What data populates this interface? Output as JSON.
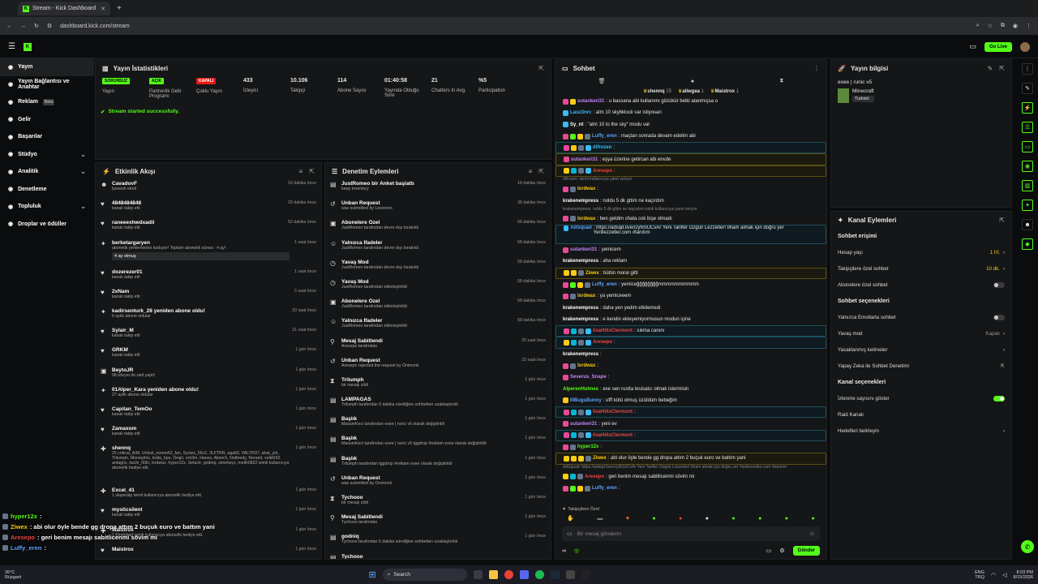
{
  "browser": {
    "tab_title": "Stream - Kick Dashboard",
    "url": "dashboard.kick.com/stream"
  },
  "topnav": {
    "go_live": "Go Live"
  },
  "sidebar": [
    {
      "label": "Yayın",
      "icon": "broadcast-icon",
      "active": true
    },
    {
      "label": "Yayın Bağlantısı ve Anahtar",
      "icon": "link-icon"
    },
    {
      "label": "Reklam",
      "icon": "ad-icon",
      "badge": "Beta"
    },
    {
      "label": "Gelir",
      "icon": "dollar-icon"
    },
    {
      "label": "Başarılar",
      "icon": "trophy-icon"
    },
    {
      "label": "Stüdyo",
      "icon": "studio-icon",
      "chev": "⌄"
    },
    {
      "label": "Analitik",
      "icon": "chart-icon",
      "chev": "⌄"
    },
    {
      "label": "Denetleme",
      "icon": "gavel-icon"
    },
    {
      "label": "Topluluk",
      "icon": "people-icon",
      "chev": "⌄"
    },
    {
      "label": "Droplar ve ödüller",
      "icon": "gift-icon"
    }
  ],
  "stats": {
    "title": "Yayın İstatistikleri",
    "items": [
      {
        "badge": "SORUNSUZ",
        "badge_color": "#53fc18",
        "label": "Yayın"
      },
      {
        "badge": "AÇIK",
        "badge_color": "#53fc18",
        "label": "Partnerlik Gelir Programı"
      },
      {
        "badge": "KAPALI",
        "badge_color": "#e91916",
        "label": "Çoklu Yayın"
      },
      {
        "value": "433",
        "label": "İzleyici"
      },
      {
        "value": "10.106",
        "label": "Takipçi"
      },
      {
        "value": "114",
        "label": "Abone Sayısı"
      },
      {
        "value": "01:40:58",
        "label": "Yayında Olduğu Süre"
      },
      {
        "value": "21",
        "label": "Chatters In Avg."
      },
      {
        "value": "%5",
        "label": "Participation"
      }
    ],
    "toast": "Stream started successfully."
  },
  "activity": {
    "title": "Etkinlik Akışı",
    "rows": [
      {
        "i": "☻",
        "n": "CavadovF",
        "s": "lyesesh ekrdı",
        "t": "16 dakika önce"
      },
      {
        "i": "♥",
        "n": "4848484848",
        "s": "kanalı takip etti",
        "t": "20 dakika önce"
      },
      {
        "i": "♥",
        "n": "raneeexhwdxadil",
        "s": "kanalı takip etti",
        "t": "52 dakika önce"
      },
      {
        "i": "✦",
        "n": "berketargaryen",
        "s": "abonelik yenilemesini kutluyor! Toplam abonelik süresi - 4 ay!",
        "t": "1 saat önce",
        "x": "4 ay olmuş"
      },
      {
        "i": "♥",
        "n": "dozerezer01",
        "s": "kanalı takip etti",
        "t": "1 saat önce"
      },
      {
        "i": "♥",
        "n": "2xNam",
        "s": "kanalı takip etti",
        "t": "5 saat önce"
      },
      {
        "i": "✦",
        "n": "kadirsenturk_28 yeniden abone oldu!",
        "s": "6 aylık abone oldular",
        "t": "20 saat önce"
      },
      {
        "i": "♥",
        "n": "Sylair_M",
        "s": "kanalı takip etti",
        "t": "21 saat önce"
      },
      {
        "i": "♥",
        "n": "GRKM",
        "s": "kanalı takip etti",
        "t": "1 gün önce"
      },
      {
        "i": "▣",
        "n": "BeytoJR",
        "s": "98 izleyici ile raid yaptı!",
        "t": "1 gün önce"
      },
      {
        "i": "✦",
        "n": "01Alper_Kara yeniden abone oldu!",
        "s": "27 aylık abone oldular",
        "t": "1 gün önce"
      },
      {
        "i": "♥",
        "n": "Capitan_TemOo",
        "s": "kanalı takip etti",
        "t": "1 gün önce"
      },
      {
        "i": "♥",
        "n": "Zamaxom",
        "s": "kanalı takip etti",
        "t": "1 gün önce"
      },
      {
        "i": "✚",
        "n": "shennq",
        "s": "25 critical_AIM, Unlost_memo62_fan, Synizx_56v2, 3LFTRN, aga60, VALYR37, ahat_yrk, Trilumph, Morsephix, bolta_hpo, Orajri, erk3m, Hanex, AlizerX, Notfeedy, Noraml, volkl043, antagnz, itachi_00ln, lxrdwax, hyper12x, Sefactr, godniq, simetwyz, melih0822 isimli kullanıcıya abonelik hediye etti.",
        "t": "1 gün önce",
        "tall": true
      },
      {
        "i": "✚",
        "n": "Excel_41",
        "s": "1 slayeralp isimli kullanıcıya abonelik hediye etti.",
        "t": "1 gün önce"
      },
      {
        "i": "♥",
        "n": "mysticsilent",
        "s": "kanalı takip etti",
        "t": "1 gün önce"
      },
      {
        "i": "✚",
        "n": "Maistrox",
        "s": "1 Kirplebad isimli kullanıcıya abonelik hediye etti.",
        "t": "1 gün önce"
      },
      {
        "i": "♥",
        "n": "Maistrox",
        "s": "",
        "t": "1 gün önce"
      }
    ]
  },
  "moderation": {
    "title": "Denetim Eylemleri",
    "rows": [
      {
        "i": "▤",
        "n": "JustRomeo bir Anket başlattı",
        "s": "keep inventory",
        "t": "18 dakika önce"
      },
      {
        "i": "↺",
        "n": "Unban Request",
        "s": "was submitted by Lexionnn",
        "t": "38 dakika önce"
      },
      {
        "i": "▣",
        "n": "Abonelere Özel",
        "s": "JustRomeo tarafından devre dışı bırakıldı",
        "t": "58 dakika önce"
      },
      {
        "i": "☺",
        "n": "Yalnızca İfadeler",
        "s": "JustRomeo tarafından devre dışı bırakıldı",
        "t": "58 dakika önce"
      },
      {
        "i": "◷",
        "n": "Yavaş Mod",
        "s": "JustRomeo tarafından devre dışı bırakıldı",
        "t": "58 dakika önce"
      },
      {
        "i": "◷",
        "n": "Yavaş Mod",
        "s": "JustRomeo tarafından etkinleştirildi",
        "t": "58 dakika önce"
      },
      {
        "i": "▣",
        "n": "Abonelere Özel",
        "s": "JustRomeo tarafından etkinleştirildi",
        "t": "58 dakika önce"
      },
      {
        "i": "☺",
        "n": "Yalnızca İfadeler",
        "s": "JustRomeo tarafından etkinleştirildi",
        "t": "58 dakika önce"
      },
      {
        "i": "⚲",
        "n": "Mesaj Sabitlendi",
        "s": "Aresepo tarafından",
        "t": "20 saat önce"
      },
      {
        "i": "↺",
        "n": "Unban Request",
        "s": "Aresepo rejected the request by Onimonii",
        "t": "22 saat önce"
      },
      {
        "i": "⧗",
        "n": "Trilumph",
        "s": "bir mesajı sildi",
        "t": "1 gün önce"
      },
      {
        "i": "▤",
        "n": "LAMPAGAS",
        "s": "Trilumph tarafından 5 dakika süreliğine sohbetten uzaklaştırıldı",
        "t": "1 gün önce"
      },
      {
        "i": "▤",
        "n": "Başlık",
        "s": "MasumKeci tarafından exee | runic v5 olarak değiştirildi",
        "t": "1 gün önce"
      },
      {
        "i": "▤",
        "n": "Başlık",
        "s": "MasumKeci tarafından exee | runic v5 tggdrop #reklam exee olarak değiştirildi",
        "t": "1 gün önce"
      },
      {
        "i": "▤",
        "n": "Başlık",
        "s": "Trilumph tarafından tggdrop #reklam exee olarak değiştirildi",
        "t": "1 gün önce"
      },
      {
        "i": "↺",
        "n": "Unban Request",
        "s": "was submitted by Onimonii",
        "t": "1 gün önce"
      },
      {
        "i": "⧗",
        "n": "Tychooo",
        "s": "bir mesajı sildi",
        "t": "1 gün önce"
      },
      {
        "i": "⚲",
        "n": "Mesaj Sabitlendi",
        "s": "Tychooo tarafından",
        "t": "1 gün önce"
      },
      {
        "i": "▤",
        "n": "godniq",
        "s": "Tychooo tarafından 5 dakika süreliğine sohbetten uzaklaştırıldı",
        "t": "1 gün önce"
      },
      {
        "i": "▤",
        "n": "Tychooo",
        "s": "",
        "t": ""
      }
    ]
  },
  "chat": {
    "title": "Sohbet",
    "top_users": [
      {
        "n": "shennq",
        "c": "25"
      },
      {
        "n": "aliwgea",
        "c": "1"
      },
      {
        "n": "Maistrox",
        "c": "1"
      }
    ],
    "lines": [
      {
        "u": "sutankeri31",
        "c": "#c084fc",
        "m": ": u bassana abi kullanımı gözükür belki atanmışsa o",
        "b": [
          "#ec4899",
          "#facc15"
        ]
      },
      {
        "u": "Lauz3nrc",
        "c": "#38bdf8",
        "m": ": atm 10 skybklock var istiyosan",
        "b": [
          "#38bdf8"
        ]
      },
      {
        "u": "Sy_nt",
        "c": "#fff",
        "m": ": \"atm 10 to the sky\" modu var",
        "b": [
          "#38bdf8"
        ]
      },
      {
        "u": "Luffy_eren",
        "c": "#60a5fa",
        "m": ": maçtan sonrada devam edelim abi",
        "b": [
          "#ec4899",
          "#53fc18",
          "#facc15",
          "#64748b"
        ]
      },
      {
        "u": "difrozen",
        "c": "#38bdf8",
        "m": ":",
        "b": [
          "#ec4899",
          "#facc15",
          "#64748b",
          "#38bdf8"
        ],
        "cls": "bl"
      },
      {
        "u": "sutankeri31",
        "c": "#c084fc",
        "m": ": eşya üzerine getircan abi envde",
        "b": [
          "#ec4899"
        ],
        "cls": "hl"
      },
      {
        "u": "Aresepo",
        "c": "#ef4444",
        "m": ":",
        "b": [
          "#facc15",
          "#06b6d4",
          "#64748b",
          "#38bdf8"
        ],
        "cls": "hl"
      },
      {
        "u": "lxrdwax",
        "c": "#facc15",
        "m": ":",
        "b": [
          "#ec4899",
          "#64748b"
        ],
        "reply": "difrozen: isimli kullanıcıya yanıt veriyor"
      },
      {
        "u": "krakenempress",
        "c": "#fff",
        "m": ": noldu 5 dk gttim ne kaçırdım",
        "b": []
      },
      {
        "u": "lxrdwax",
        "c": "#facc15",
        "m": ": ben geldim chata cok bişe olmadı",
        "b": [
          "#ec4899",
          "#64748b"
        ],
        "reply": "krakenempress: noldu 5 dk gttim ne kaçırdım isimli kullanıcıya yanıt veriyor"
      },
      {
        "u": "AdSquad",
        "c": "#60a5fa",
        "m": ": https://adsqd.live/c/yNSUCvAr Yeni Tarifler Özgün Lezzetler! İlham almak için doğru yer Yenilezzetler.com #tanıtım",
        "b": [
          "#38bdf8"
        ],
        "cls": "bl",
        "tall": true
      },
      {
        "u": "sutankeri31",
        "c": "#c084fc",
        "m": ": yemicem",
        "b": [
          "#ec4899"
        ]
      },
      {
        "u": "krakenempress",
        "c": "#fff",
        "m": ": aha reklam",
        "b": []
      },
      {
        "u": "Ziwex",
        "c": "#facc15",
        "m": ": bütün moral gitti",
        "b": [
          "#facc15",
          "#facc15",
          "#64748b"
        ],
        "cls": "hl"
      },
      {
        "u": "Luffy_eren",
        "c": "#60a5fa",
        "m": ": yemiceğğğğğğğğmmmmmmmmmm",
        "b": [
          "#ec4899",
          "#53fc18",
          "#facc15",
          "#64748b"
        ]
      },
      {
        "u": "lxrdwax",
        "c": "#facc15",
        "m": ": ya yemiceeem",
        "b": [
          "#ec4899",
          "#64748b"
        ]
      },
      {
        "u": "krakenempress",
        "c": "#fff",
        "m": ": daha yen yedim etkilemedi",
        "b": []
      },
      {
        "u": "krakenempress",
        "c": "#fff",
        "m": ": e kendin ekleyemiyormusun modun içine",
        "b": []
      },
      {
        "u": "lisaHillsClermont",
        "c": "#ef4444",
        "m": ": sıkma canını",
        "b": [
          "#ec4899",
          "#06b6d4",
          "#64748b",
          "#38bdf8"
        ],
        "cls": "bl"
      },
      {
        "u": "Aresepo",
        "c": "#ef4444",
        "m": ":",
        "b": [
          "#facc15",
          "#06b6d4",
          "#64748b",
          "#38bdf8"
        ],
        "cls": "bl"
      },
      {
        "u": "krakenempress",
        "c": "#fff",
        "m": ":",
        "b": []
      },
      {
        "u": "lxrdwax",
        "c": "#facc15",
        "m": ":",
        "b": [
          "#ec4899",
          "#64748b"
        ]
      },
      {
        "u": "Severus_Snape",
        "c": "#c084fc",
        "m": ":",
        "b": [
          "#ec4899"
        ]
      },
      {
        "u": "AlperenHolmes",
        "c": "#53fc18",
        "m": ": exe sen rustta tesisatcı olmak istermisin",
        "b": []
      },
      {
        "u": "IllBugsBunny",
        "c": "#60a5fa",
        "m": ": ufff kötü olmuş üzüldüm bebeğim",
        "b": [
          "#facc15"
        ]
      },
      {
        "u": "lisaHillsClermont",
        "c": "#ef4444",
        "m": ":",
        "b": [
          "#ec4899",
          "#06b6d4",
          "#64748b",
          "#38bdf8"
        ],
        "cls": "bl"
      },
      {
        "u": "sutankeri31",
        "c": "#c084fc",
        "m": ": yeni ev",
        "b": [
          "#ec4899"
        ]
      },
      {
        "u": "lisaHillsClermont",
        "c": "#ef4444",
        "m": ":",
        "b": [
          "#ec4899",
          "#06b6d4",
          "#64748b",
          "#38bdf8"
        ],
        "cls": "bl"
      },
      {
        "u": "hyper12x",
        "c": "#53fc18",
        "m": ":",
        "b": [
          "#ec4899",
          "#64748b"
        ]
      },
      {
        "u": "Ziwex",
        "c": "#facc15",
        "m": ": abi olur öyle bende gg dropa attım 2 buçuk euro ve battım yani",
        "b": [
          "#facc15",
          "#facc15",
          "#facc15",
          "#64748b"
        ],
        "cls": "hl"
      },
      {
        "u": "Aresepo",
        "c": "#ef4444",
        "m": ": geri benim mesajı sabitlicenmi sövim mi",
        "b": [
          "#facc15",
          "#06b6d4",
          "#64748b"
        ],
        "reply": "AdSquad: https://adsqd.live/c/yNSUCvAr Yeni Tarifler Özgün Lezzetler! İlham almak için doğru yer Yenilezzetler.com #tanıtım"
      },
      {
        "u": "Luffy_eren",
        "c": "#60a5fa",
        "m": ":",
        "b": [
          "#ec4899",
          "#53fc18",
          "#facc15",
          "#64748b"
        ]
      }
    ],
    "subs_label": "Takipçilere Özel",
    "placeholder": "Bir mesaj gönderin",
    "send": "Gönder"
  },
  "stream_info": {
    "title": "Yayın bilgisi",
    "stream_title": "exee | runic v5",
    "category": "Minecraft",
    "tag": "Turkish"
  },
  "channel_actions": {
    "title": "Kanal Eylemleri",
    "chat_access": "Sohbet erişimi",
    "access_rows": [
      {
        "l": "Hesap yaşı",
        "v": "1 hf."
      },
      {
        "l": "Takipçilere özel sohbet",
        "v": "10 dk."
      },
      {
        "l": "Abonelere özel sohbet",
        "toggle": false
      }
    ],
    "chat_options": "Sohbet seçenekleri",
    "option_rows": [
      {
        "l": "Yalnızca Emotlarla sohbet",
        "toggle": false
      },
      {
        "l": "Yavaş mod",
        "v": "Kapalı"
      },
      {
        "l": "Yasaklanmış kelimeler",
        "v": ""
      },
      {
        "l": "Yapay Zeka ile Sohbet Denetimi",
        "v": "ext"
      }
    ],
    "channel_options": "Kanal seçenekleri",
    "channel_rows": [
      {
        "l": "İzlenme sayısını göster",
        "toggle": true
      },
      {
        "l": "Raid Kanalı"
      },
      {
        "l": "Hedefleri belirleyin",
        "v": ""
      }
    ]
  },
  "overlay": [
    {
      "u": "hyper12x",
      "c": "#53fc18",
      "m": ":"
    },
    {
      "u": "Ziwex",
      "c": "#facc15",
      "m": ": abi olur öyle bende gg dropa attım 2 buçuk euro ve battım yani"
    },
    {
      "u": "Aresepo",
      "c": "#ef4444",
      "m": ": geri benim mesajı sabitlicenmi sövim mi"
    },
    {
      "u": "Luffy_eren",
      "c": "#60a5fa",
      "m": ":"
    }
  ],
  "taskbar": {
    "weather_temp": "26°C",
    "weather_desc": "Rüzgarlı",
    "search": "Search",
    "lang": "ENG",
    "lang2": "TRQ",
    "time": "8:03 PM",
    "date": "8/15/2026"
  }
}
